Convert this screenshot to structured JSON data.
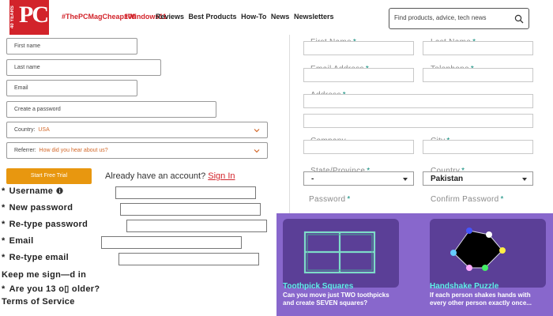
{
  "header": {
    "logo": {
      "years": "40 YEARS",
      "text": "PC"
    },
    "highlights": [
      "#ThePCMagCheap100",
      "#Windows11"
    ],
    "nav": [
      "Reviews",
      "Best Products",
      "How-To",
      "News",
      "Newsletters"
    ],
    "search": {
      "placeholder": "Find products, advice, tech news",
      "icon": "search-icon"
    },
    "brand_color": "#d2232a"
  },
  "signup_form": {
    "first_name_placeholder": "First name",
    "last_name_placeholder": "Last name",
    "email_placeholder": "Email",
    "password_placeholder": "Create a password",
    "country": {
      "label": "Country:",
      "value": "USA"
    },
    "referrer": {
      "label": "Referrer:",
      "value": "How did you hear about us?"
    },
    "start_button": "Start Free Trial",
    "have_account_text": "Already have an account?",
    "sign_in_link": "Sign In"
  },
  "account_form": {
    "username": "Username",
    "new_password": "New password",
    "retype_password": "Re-type password",
    "email": "Email",
    "retype_email": "Re-type email",
    "keep_signed_in": "Keep me sign—d in",
    "age_question": "Are you 13 o▯ older?",
    "terms": "Terms of Service",
    "star": "*"
  },
  "contact_form": {
    "first_name": "First Name",
    "last_name": "Last Name",
    "email_address": "Email Address",
    "telephone": "Telephone",
    "address": "Address",
    "company": "Company",
    "city": "City",
    "state": "State/Province",
    "state_value": "-",
    "country": "Country",
    "country_value": "Pakistan",
    "password": "Password",
    "confirm_password": "Confirm Password",
    "required_mark": "*"
  },
  "puzzles": [
    {
      "title": "Toothpick Squares",
      "description": "Can you move just TWO toothpicks and create SEVEN squares?"
    },
    {
      "title": "Handshake Puzzle",
      "description": "If each person shakes hands with every other person exactly once..."
    }
  ],
  "colors": {
    "accent_orange": "#e8970f",
    "puzzle_bg": "#8867cc",
    "puzzle_card": "#5b3f97",
    "puzzle_title": "#5ef0e8",
    "required": "#0a8a7a"
  }
}
